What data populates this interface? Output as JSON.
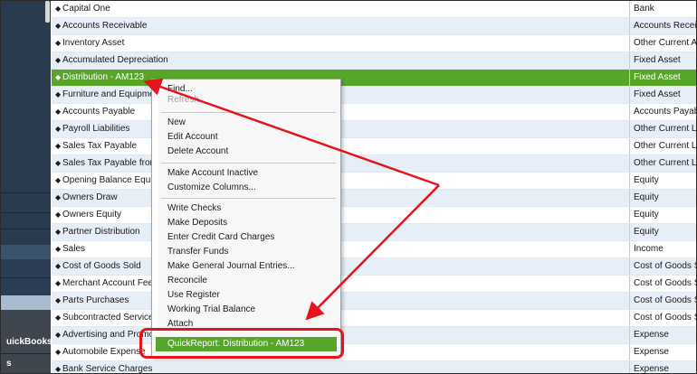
{
  "nav": {
    "quickbooks_label": "uickBooks",
    "last_label": "s"
  },
  "accounts": [
    {
      "name": "Capital One",
      "type": "Bank"
    },
    {
      "name": "Accounts Receivable",
      "type": "Accounts Receiva"
    },
    {
      "name": "Inventory Asset",
      "type": "Other Current Ass"
    },
    {
      "name": "Accumulated Depreciation",
      "type": "Fixed Asset"
    },
    {
      "name": "Distribution - AM123",
      "type": "Fixed Asset"
    },
    {
      "name": "Furniture and Equipme",
      "type": "Fixed Asset"
    },
    {
      "name": "Accounts Payable",
      "type": "Accounts Payable"
    },
    {
      "name": "Payroll Liabilities",
      "type": "Other Current Lia"
    },
    {
      "name": "Sales Tax Payable",
      "type": "Other Current Lia"
    },
    {
      "name": "Sales Tax Payable from",
      "type": "Other Current Lia"
    },
    {
      "name": "Opening Balance Equi",
      "type": "Equity"
    },
    {
      "name": "Owners Draw",
      "type": "Equity"
    },
    {
      "name": "Owners Equity",
      "type": "Equity"
    },
    {
      "name": "Partner Distribution",
      "type": "Equity"
    },
    {
      "name": "Sales",
      "type": "Income"
    },
    {
      "name": "Cost of Goods Sold",
      "type": "Cost of Goods Sc"
    },
    {
      "name": "Merchant Account Fees",
      "type": "Cost of Goods Sc"
    },
    {
      "name": "Parts Purchases",
      "type": "Cost of Goods Sc"
    },
    {
      "name": "Subcontracted Services",
      "type": "Cost of Goods Sc"
    },
    {
      "name": "Advertising and Promo",
      "type": "Expense"
    },
    {
      "name": "Automobile Expense",
      "type": "Expense"
    },
    {
      "name": "Bank Service Charges",
      "type": "Expense"
    }
  ],
  "menu": {
    "find": "Find...",
    "refresh": "Refresh",
    "new": "New",
    "edit_account": "Edit Account",
    "delete_account": "Delete Account",
    "make_inactive": "Make Account Inactive",
    "customize_columns": "Customize Columns...",
    "write_checks": "Write Checks",
    "make_deposits": "Make Deposits",
    "enter_credit_card_charges": "Enter Credit Card Charges",
    "transfer_funds": "Transfer Funds",
    "make_journal_entries": "Make General Journal Entries...",
    "reconcile": "Reconcile",
    "use_register": "Use Register",
    "working_trial_balance": "Working Trial Balance",
    "attach": "Attach",
    "quickreport": "QuickReport: Distribution - AM123"
  },
  "colors": {
    "selection_green": "#58a629",
    "annotation_red": "#e5141c",
    "nav_dark": "#253446"
  }
}
